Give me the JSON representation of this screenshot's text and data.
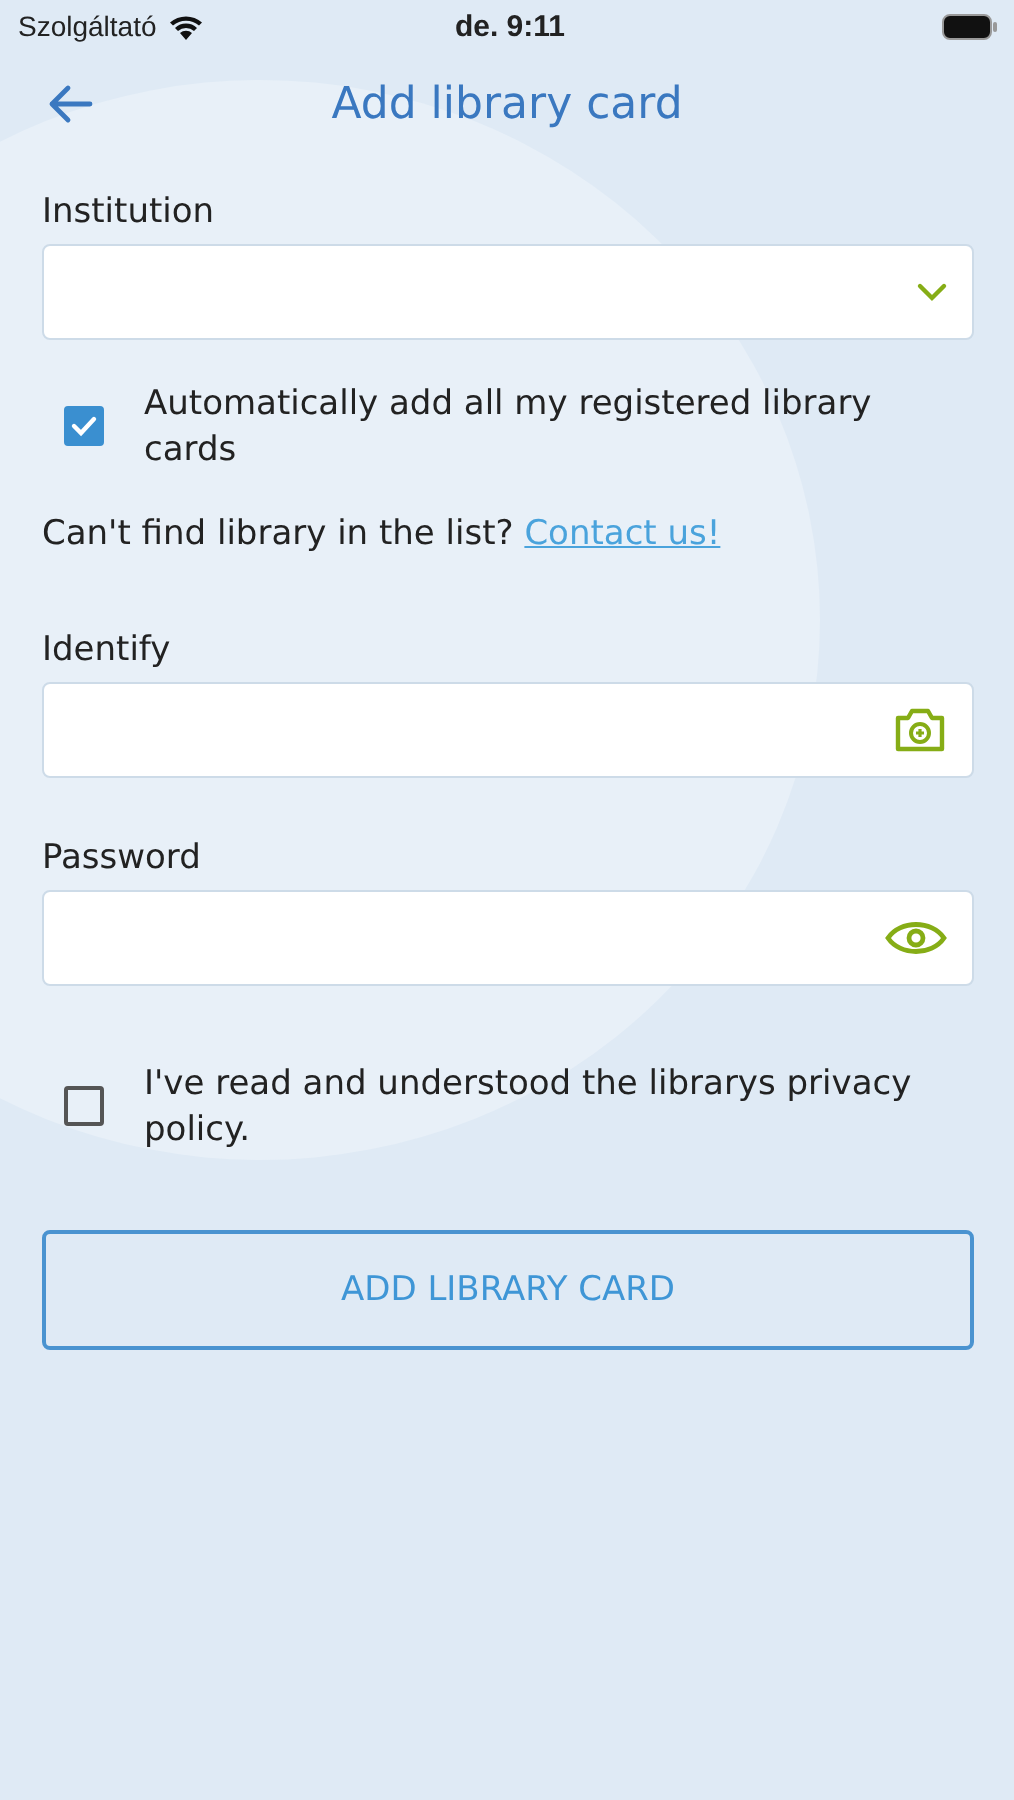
{
  "status_bar": {
    "carrier": "Szolgáltató",
    "time": "de. 9:11"
  },
  "header": {
    "title": "Add library card"
  },
  "institution": {
    "label": "Institution",
    "kind": "select"
  },
  "auto_add": {
    "label": "Automatically add all my registered library cards",
    "checked": true
  },
  "help": {
    "text": "Can't find library in the list?",
    "link": "Contact us!"
  },
  "fields": [
    {
      "label": "Identify",
      "kind": "camera"
    },
    {
      "label": "Password",
      "kind": "password"
    }
  ],
  "privacy": {
    "label": "I've read and understood the librarys privacy policy.",
    "checked": false
  },
  "submit": {
    "label": "ADD LIBRARY CARD"
  }
}
